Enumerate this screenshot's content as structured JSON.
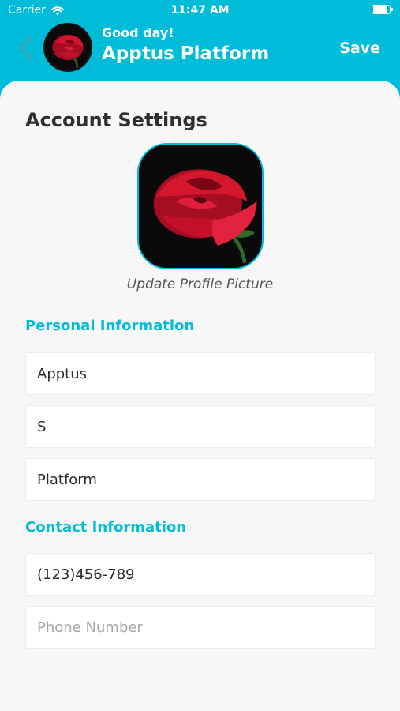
{
  "status_bar": {
    "carrier": "Carrier",
    "time": "11:47 AM",
    "battery_level": 0.95
  },
  "header": {
    "greeting": "Good day!",
    "name": "Apptus Platform",
    "save_label": "Save"
  },
  "page": {
    "title": "Account Settings",
    "update_picture_label": "Update Profile Picture",
    "personal_section": {
      "title": "Personal Information",
      "fields": [
        {
          "value": "Apptus",
          "placeholder": ""
        },
        {
          "value": "S",
          "placeholder": ""
        },
        {
          "value": "Platform",
          "placeholder": ""
        }
      ]
    },
    "contact_section": {
      "title": "Contact Information",
      "fields": [
        {
          "value": "(123)456-789",
          "placeholder": ""
        },
        {
          "value": "",
          "placeholder": "Phone Number"
        }
      ]
    }
  },
  "colors": {
    "accent": "#00bcd8",
    "card_background": "#f7f7f7",
    "rose_red": "#c8102e"
  }
}
